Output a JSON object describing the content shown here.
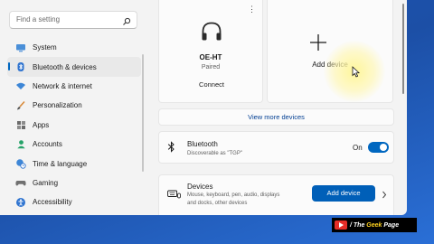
{
  "search": {
    "placeholder": "Find a setting"
  },
  "sidebar": {
    "items": [
      {
        "label": "System",
        "icon": "monitor-icon",
        "active": false
      },
      {
        "label": "Bluetooth & devices",
        "icon": "bluetooth-icon",
        "active": true
      },
      {
        "label": "Network & internet",
        "icon": "wifi-icon",
        "active": false
      },
      {
        "label": "Personalization",
        "icon": "brush-icon",
        "active": false
      },
      {
        "label": "Apps",
        "icon": "apps-icon",
        "active": false
      },
      {
        "label": "Accounts",
        "icon": "person-icon",
        "active": false
      },
      {
        "label": "Time & language",
        "icon": "globe-clock-icon",
        "active": false
      },
      {
        "label": "Gaming",
        "icon": "controller-icon",
        "active": false
      },
      {
        "label": "Accessibility",
        "icon": "accessibility-icon",
        "active": false
      }
    ]
  },
  "device_card": {
    "name": "OE-HT",
    "status": "Paired",
    "action": "Connect",
    "more": "⋮"
  },
  "add_card": {
    "label": "Add device"
  },
  "view_more": "View more devices",
  "bluetooth_row": {
    "title": "Bluetooth",
    "subtitle": "Discoverable as \"TGP\"",
    "state_label": "On",
    "on": true
  },
  "devices_row": {
    "title": "Devices",
    "subtitle_line1": "Mouse, keyboard, pen, audio, displays",
    "subtitle_line2": "and docks, other devices",
    "button": "Add device"
  },
  "watermark": {
    "prefix": "/ The ",
    "highlight": "Geek",
    "suffix": " Page"
  },
  "colors": {
    "accent": "#0067c0",
    "button": "#005fb8",
    "desktop": "#1e57b8",
    "window": "#f3f3f3"
  }
}
